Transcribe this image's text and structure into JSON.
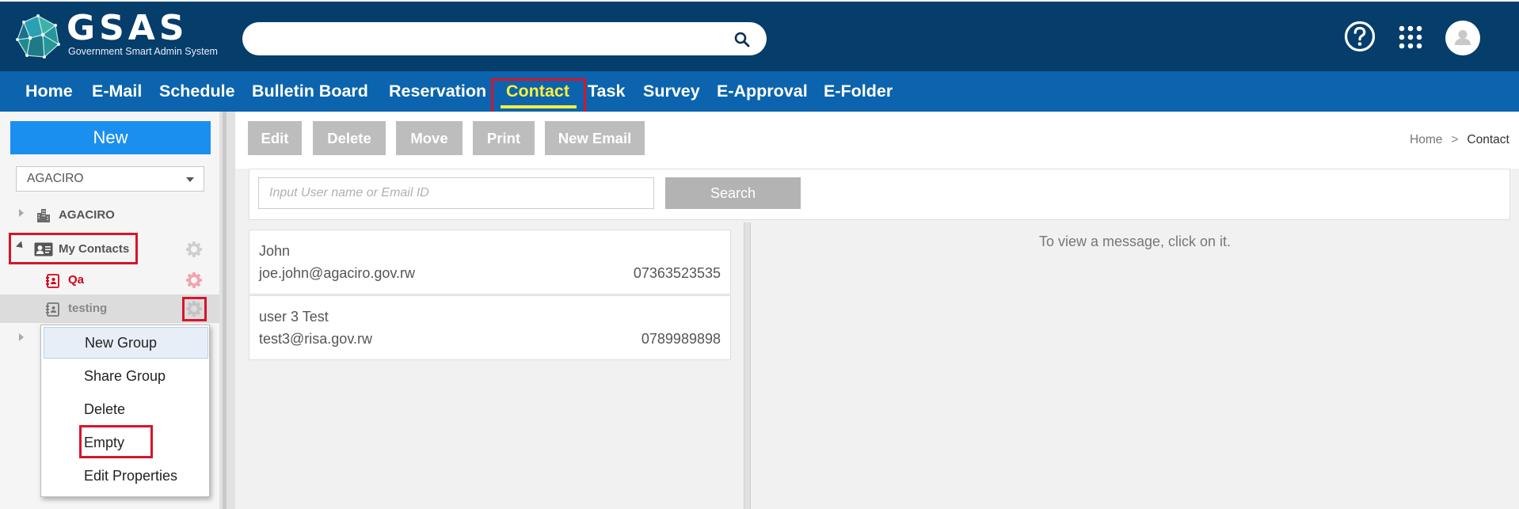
{
  "header": {
    "logo_text": "GSAS",
    "logo_subtitle": "Government Smart Admin System",
    "search_placeholder": "",
    "icons": [
      "search-icon",
      "help-icon",
      "apps-grid-icon",
      "user-avatar-icon"
    ]
  },
  "nav": {
    "items": [
      {
        "label": "Home"
      },
      {
        "label": "E-Mail"
      },
      {
        "label": "Schedule"
      },
      {
        "label": "Bulletin Board"
      },
      {
        "label": "Reservation"
      },
      {
        "label": "Contact",
        "active": true
      },
      {
        "label": "Task"
      },
      {
        "label": "Survey"
      },
      {
        "label": "E-Approval"
      },
      {
        "label": "E-Folder"
      }
    ]
  },
  "sidebar": {
    "new_button": "New",
    "org_select": {
      "value": "AGACIRO"
    },
    "tree": [
      {
        "label": "AGACIRO",
        "icon": "building-icon",
        "expanded": false
      },
      {
        "label": "My Contacts",
        "icon": "contact-card-icon",
        "expanded": true
      },
      {
        "label": "Qa",
        "icon": "address-book-icon",
        "color": "#d0021b"
      },
      {
        "label": "testing",
        "icon": "address-book-icon",
        "selected": true
      }
    ],
    "context_menu": [
      {
        "label": "New Group"
      },
      {
        "label": "Share Group"
      },
      {
        "label": "Delete"
      },
      {
        "label": "Empty"
      },
      {
        "label": "Edit Properties"
      }
    ]
  },
  "toolbar": {
    "edit": "Edit",
    "delete": "Delete",
    "move": "Move",
    "print": "Print",
    "new_email": "New Email"
  },
  "breadcrumb": {
    "home": "Home",
    "separator": ">",
    "current": "Contact"
  },
  "contact_search": {
    "placeholder": "Input User name or Email ID",
    "button": "Search"
  },
  "contacts": [
    {
      "name": "John",
      "email": "joe.john@agaciro.gov.rw",
      "phone": "07363523535"
    },
    {
      "name": "user 3 Test",
      "email": "test3@risa.gov.rw",
      "phone": "0789989898"
    }
  ],
  "detail": {
    "empty_message": "To view a message, click on it."
  },
  "colors": {
    "header_bg": "#053d6b",
    "nav_bg": "#0b64ad",
    "nav_active": "#ffee3a",
    "new_button": "#1a8ff0",
    "highlight_box": "#d6152b",
    "toolbar_button": "#bdbdbd"
  }
}
